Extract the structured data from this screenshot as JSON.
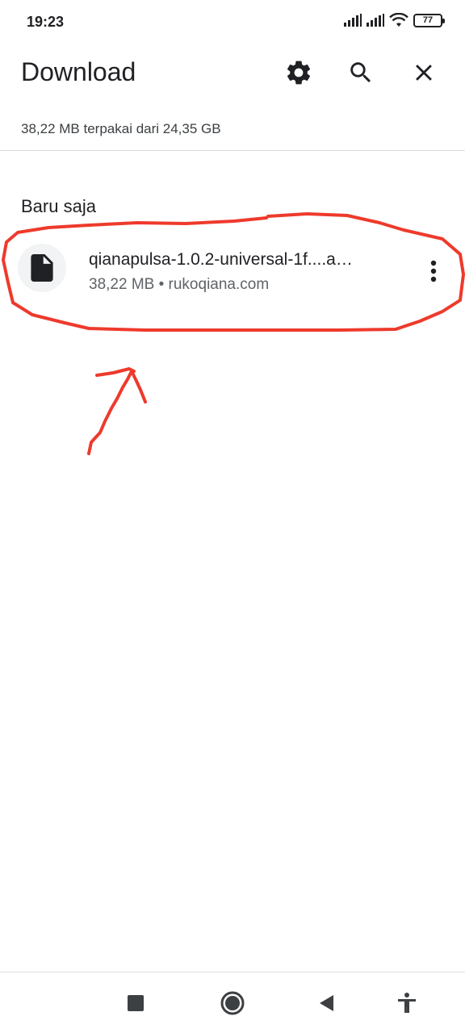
{
  "status_bar": {
    "time": "19:23",
    "battery_level": "77",
    "icons": [
      "signal-icon",
      "signal-icon",
      "wifi-icon",
      "battery-icon"
    ]
  },
  "app_bar": {
    "title": "Download",
    "actions": [
      "settings-icon",
      "search-icon",
      "close-icon"
    ]
  },
  "storage": {
    "text": "38,22 MB terpakai dari 24,35 GB"
  },
  "section": {
    "title": "Baru saja"
  },
  "download_item": {
    "file_name": "qianapulsa-1.0.2-universal-1f....a…",
    "meta": "38,22 MB • rukoqiana.com",
    "icon": "file-icon",
    "more": "more-vert-icon"
  },
  "annotation": {
    "color": "#ee3a2c"
  },
  "nav_bar": {
    "buttons": [
      "recent-apps-icon",
      "home-icon",
      "back-icon",
      "accessibility-icon"
    ]
  },
  "colors": {
    "text_primary": "#202124",
    "text_secondary": "#5f6368",
    "divider": "#dadce0"
  }
}
